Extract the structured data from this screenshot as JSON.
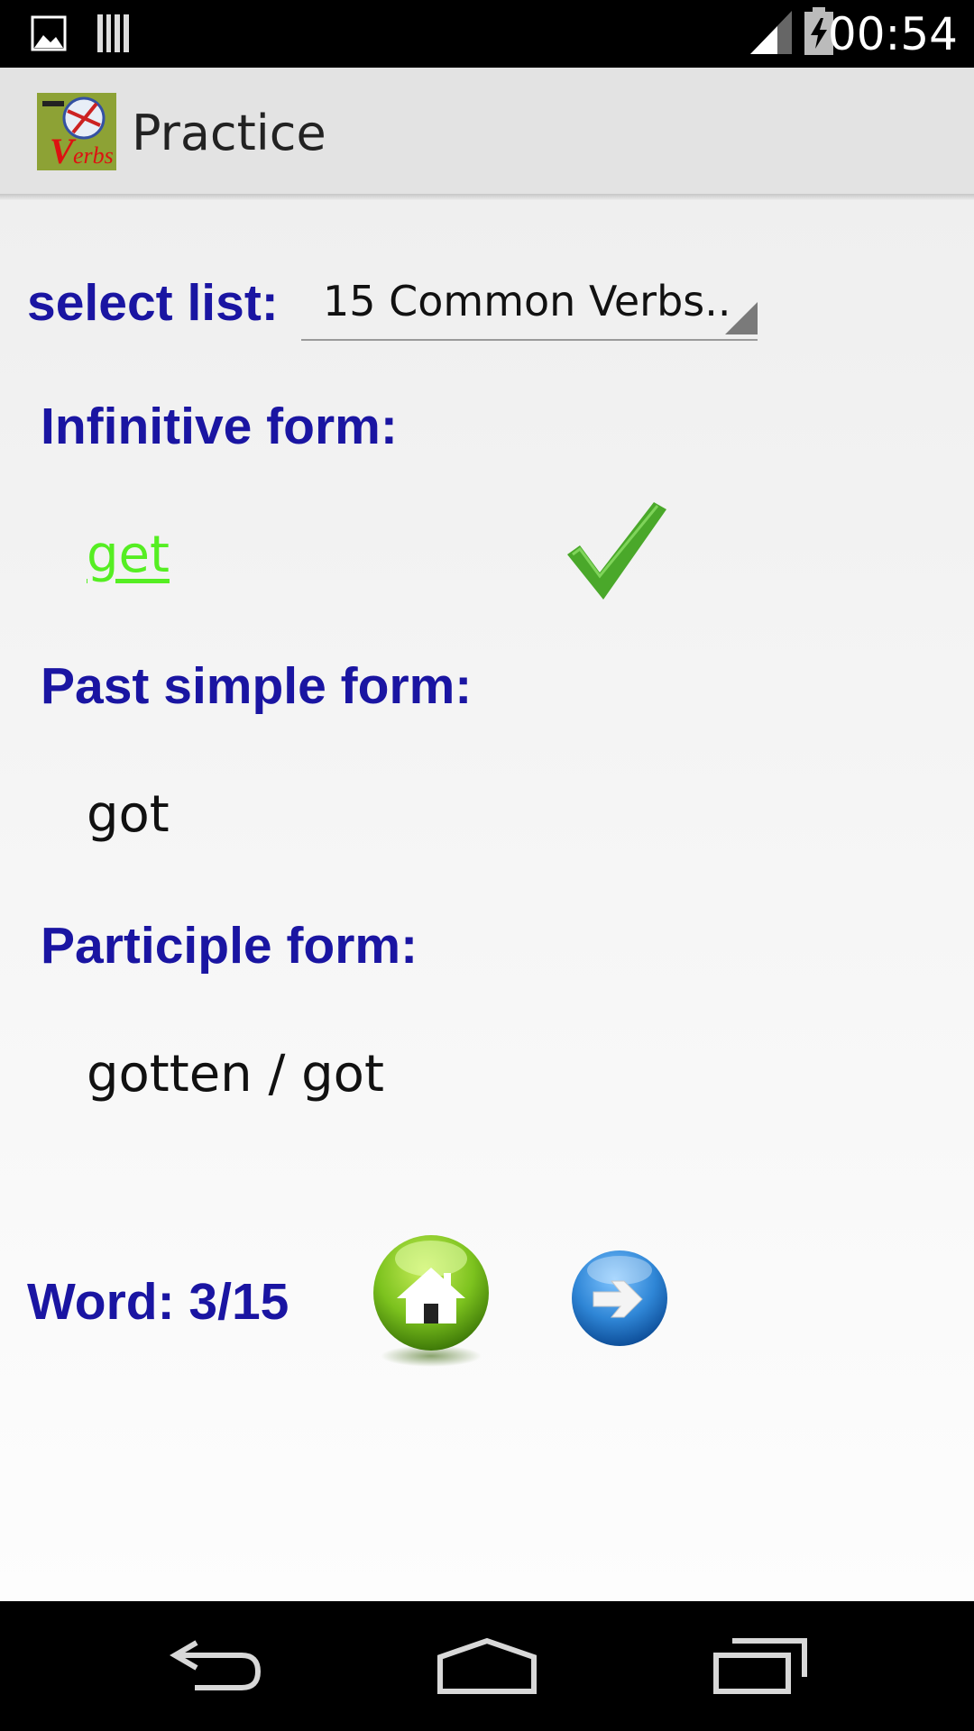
{
  "status_bar": {
    "time": "00:54",
    "icons": [
      "image-notification-icon",
      "barcode-notification-icon",
      "signal-icon",
      "battery-charging-icon"
    ]
  },
  "action_bar": {
    "title": "Practice",
    "logo_icon": "verbs-app-logo"
  },
  "practice": {
    "select_list_label": "select list:",
    "selected_list": "15 Common Verbs..",
    "infinitive_label": "Infinitive form:",
    "infinitive_value": "get",
    "infinitive_status": "correct",
    "past_simple_label": "Past simple form:",
    "past_simple_value": "got",
    "participle_label": "Participle form:",
    "participle_value": "gotten / got",
    "word_counter": "Word: 3/15"
  },
  "buttons": {
    "home_icon": "home-icon",
    "next_icon": "arrow-right-icon"
  },
  "navigation_bar": {
    "icons": [
      "back-icon",
      "home-nav-icon",
      "recents-icon"
    ]
  },
  "colors": {
    "label": "#1a15a2",
    "correct_answer": "#55ee22",
    "checkmark": "#4aa82a",
    "home_button": "#7cc21e",
    "next_button": "#2f86d6"
  }
}
